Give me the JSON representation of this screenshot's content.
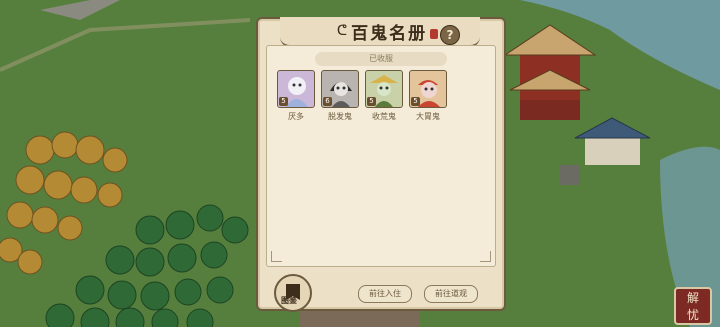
{
  "panel": {
    "title": "百鬼名册",
    "help_label": "?",
    "section_label": "已收服"
  },
  "ghosts": [
    {
      "name": "厌多",
      "level": "5"
    },
    {
      "name": "脱发鬼",
      "level": "6"
    },
    {
      "name": "收荒鬼",
      "level": "5"
    },
    {
      "name": "大胃鬼",
      "level": "5"
    }
  ],
  "buttons": {
    "book_label": "图鉴",
    "go_stay": "前往入住",
    "go_props": "前往道观"
  },
  "corner_seal": "解忧",
  "colors": {
    "panel_bg": "#ece0c6",
    "border": "#6b5a3e",
    "grass": "#4f7a3a",
    "water": "#6f9aa0",
    "tree_autumn": "#b58a34",
    "tree_green": "#2f6a36"
  }
}
